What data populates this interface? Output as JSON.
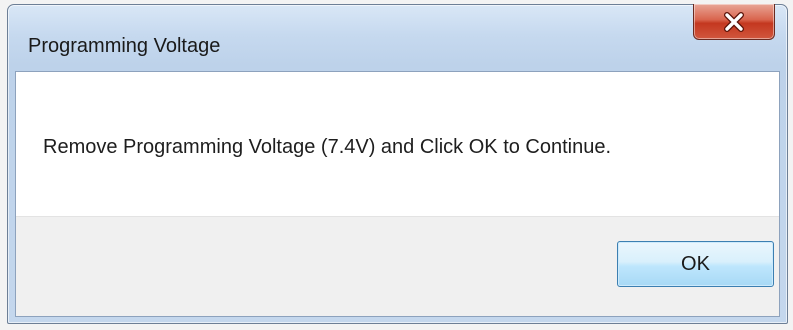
{
  "window": {
    "title": "Programming Voltage"
  },
  "message": {
    "text": "Remove Programming Voltage (7.4V) and Click OK to Continue."
  },
  "buttons": {
    "ok_label": "OK"
  },
  "icons": {
    "close": "close-icon"
  },
  "colors": {
    "close_button": "#c4381f",
    "ok_button_border": "#3c7fb1",
    "footer_background": "#f0f0f0"
  }
}
